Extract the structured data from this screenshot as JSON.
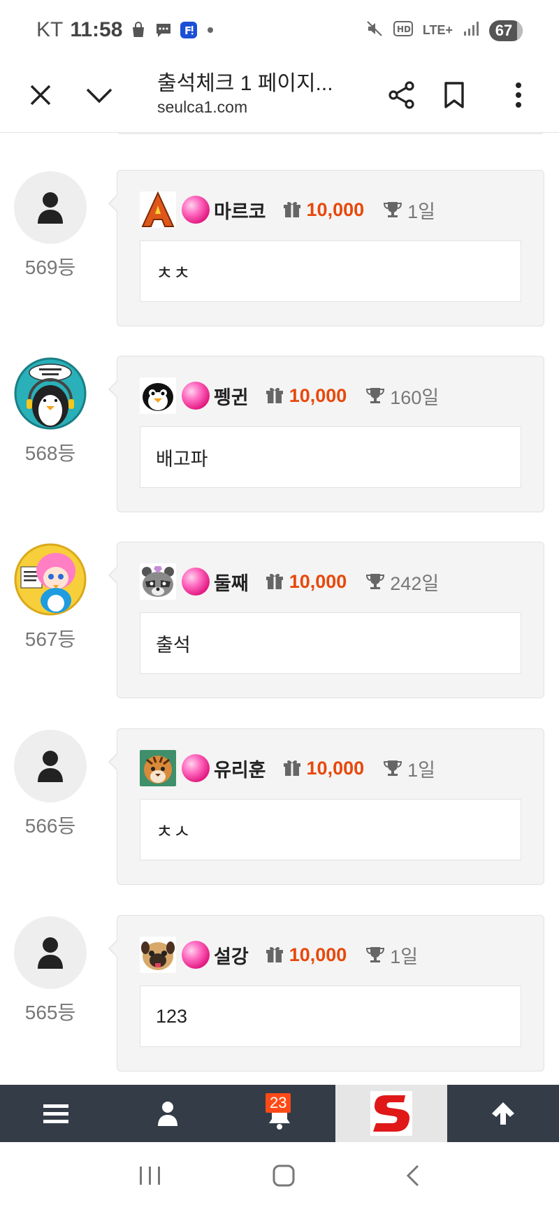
{
  "status_bar": {
    "carrier": "KT",
    "time": "11:58",
    "network": "LTE+",
    "battery": "67"
  },
  "header": {
    "title": "출석체크 1 페이지...",
    "url": "seulca1.com"
  },
  "entries": [
    {
      "rank": "569등",
      "nickname": "마르코",
      "points": "10,000",
      "days": "1일",
      "message": "ㅊㅊ",
      "avatar": "default-user-icon",
      "level_icon": "letter-a-icon"
    },
    {
      "rank": "568등",
      "nickname": "펭귄",
      "points": "10,000",
      "days": "160일",
      "message": "배고파",
      "avatar": "penguin-avatar",
      "level_icon": "penguin-icon"
    },
    {
      "rank": "567등",
      "nickname": "둘째",
      "points": "10,000",
      "days": "242일",
      "message": "출석",
      "avatar": "penguin-girl-avatar",
      "level_icon": "raccoon-icon"
    },
    {
      "rank": "566등",
      "nickname": "유리훈",
      "points": "10,000",
      "days": "1일",
      "message": "ㅊㅅ",
      "avatar": "default-user-icon",
      "level_icon": "tiger-icon"
    },
    {
      "rank": "565등",
      "nickname": "설강",
      "points": "10,000",
      "days": "1일",
      "message": "123",
      "avatar": "default-user-icon",
      "level_icon": "pug-icon"
    }
  ],
  "bottom_nav": {
    "notification_count": "23"
  },
  "colors": {
    "points": "#e8480a",
    "nav_bg": "#333c47",
    "card_bg": "#f4f4f4"
  }
}
